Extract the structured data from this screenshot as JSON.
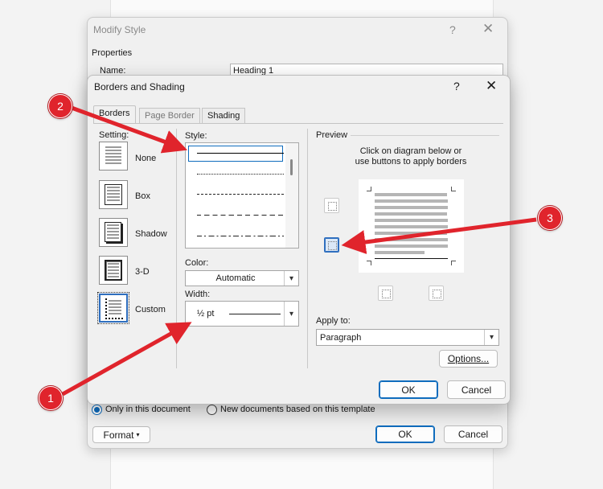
{
  "modify_style": {
    "title": "Modify Style",
    "help": "?",
    "close": "✕",
    "properties_label": "Properties",
    "name_label": "Name:",
    "name_value": "Heading 1",
    "radio_only_doc": "Only in this document",
    "radio_new_docs": "New documents based on this template",
    "format_button": "Format",
    "format_caret": "▾",
    "ok_button": "OK",
    "cancel_button": "Cancel"
  },
  "borders_dialog": {
    "title": "Borders and Shading",
    "help": "?",
    "close": "✕",
    "tabs": [
      {
        "label": "Borders",
        "active": true
      },
      {
        "label": "Page Border",
        "active": false
      },
      {
        "label": "Shading",
        "active": false
      }
    ],
    "setting_label": "Setting:",
    "settings": [
      {
        "label": "None"
      },
      {
        "label": "Box"
      },
      {
        "label": "Shadow"
      },
      {
        "label": "3-D"
      },
      {
        "label": "Custom"
      }
    ],
    "style_label": "Style:",
    "color_label": "Color:",
    "color_value": "Automatic",
    "width_label": "Width:",
    "width_value": "½ pt",
    "preview_label": "Preview",
    "preview_hint_1": "Click on diagram below or",
    "preview_hint_2": "use buttons to apply borders",
    "apply_to_label": "Apply to:",
    "apply_to_value": "Paragraph",
    "options_button": "Options...",
    "ok_button": "OK",
    "cancel_button": "Cancel"
  },
  "annotations": [
    {
      "number": "1"
    },
    {
      "number": "2"
    },
    {
      "number": "3"
    }
  ],
  "colors": {
    "accent": "#0f6cbd",
    "annotation_red": "#e0242c"
  },
  "icons": {
    "dropdown": "▾",
    "close": "✕"
  }
}
